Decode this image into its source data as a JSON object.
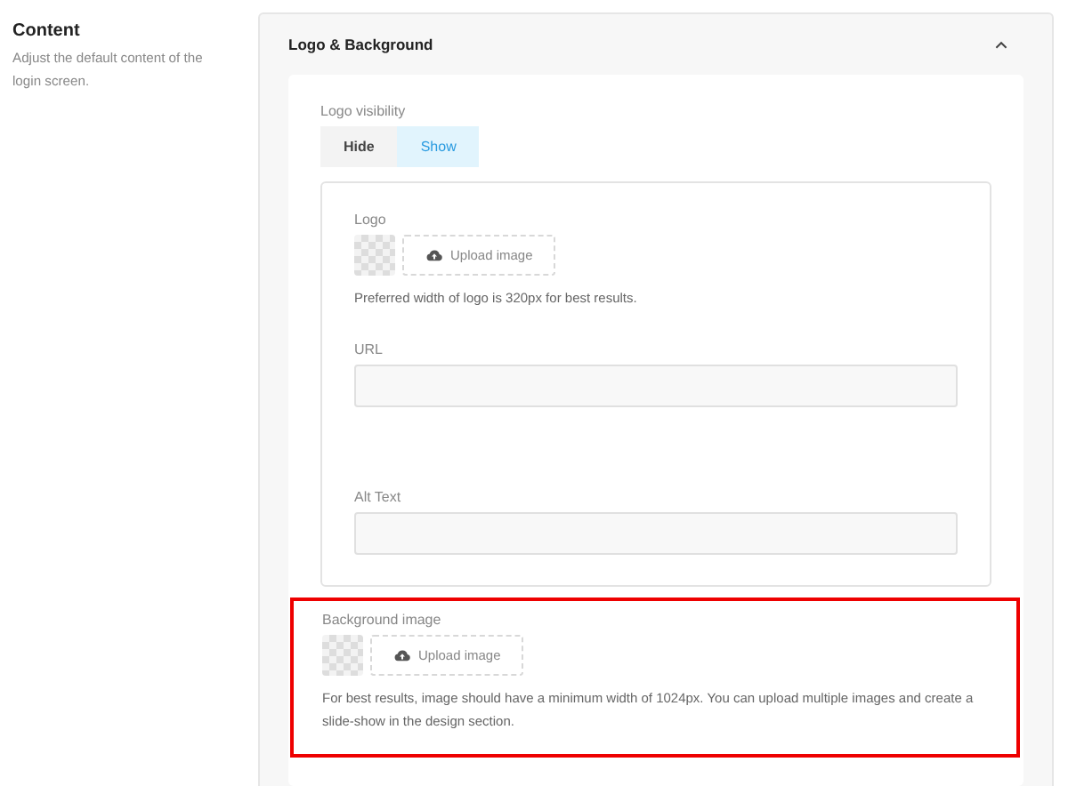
{
  "section": {
    "title": "Content",
    "description": "Adjust the default content of the login screen."
  },
  "panel": {
    "title": "Logo & Background",
    "expanded": true,
    "logo_visibility": {
      "label": "Logo visibility",
      "options": [
        {
          "label": "Hide",
          "selected": false
        },
        {
          "label": "Show",
          "selected": true
        }
      ]
    },
    "logo": {
      "label": "Logo",
      "upload_label": "Upload image",
      "help": "Preferred width of logo is 320px for best results."
    },
    "url": {
      "label": "URL"
    },
    "alt_text": {
      "label": "Alt Text"
    },
    "background_image": {
      "label": "Background image",
      "upload_label": "Upload image",
      "help": "For best results, image should have a minimum width of 1024px. You can upload multiple images and create a slide-show in the design section.",
      "highlighted": true
    }
  }
}
